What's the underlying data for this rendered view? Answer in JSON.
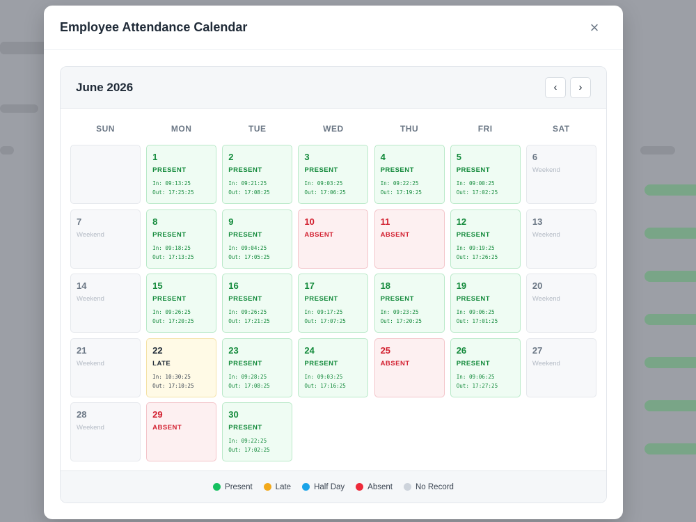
{
  "modal": {
    "title": "Employee Attendance Calendar",
    "close_symbol": "×"
  },
  "calendar": {
    "month_label": "June 2026",
    "prev_symbol": "‹",
    "next_symbol": "›",
    "weekdays": [
      "SUN",
      "MON",
      "TUE",
      "WED",
      "THU",
      "FRI",
      "SAT"
    ],
    "days": [
      {
        "type": "blank"
      },
      {
        "type": "present",
        "day": "1",
        "status": "PRESENT",
        "in": "In: 09:13:25",
        "out": "Out: 17:25:25"
      },
      {
        "type": "present",
        "day": "2",
        "status": "PRESENT",
        "in": "In: 09:21:25",
        "out": "Out: 17:08:25"
      },
      {
        "type": "present",
        "day": "3",
        "status": "PRESENT",
        "in": "In: 09:03:25",
        "out": "Out: 17:06:25"
      },
      {
        "type": "present",
        "day": "4",
        "status": "PRESENT",
        "in": "In: 09:22:25",
        "out": "Out: 17:19:25"
      },
      {
        "type": "present",
        "day": "5",
        "status": "PRESENT",
        "in": "In: 09:00:25",
        "out": "Out: 17:02:25"
      },
      {
        "type": "weekend",
        "day": "6",
        "status": "Weekend"
      },
      {
        "type": "weekend",
        "day": "7",
        "status": "Weekend"
      },
      {
        "type": "present",
        "day": "8",
        "status": "PRESENT",
        "in": "In: 09:18:25",
        "out": "Out: 17:13:25"
      },
      {
        "type": "present",
        "day": "9",
        "status": "PRESENT",
        "in": "In: 09:04:25",
        "out": "Out: 17:05:25"
      },
      {
        "type": "absent",
        "day": "10",
        "status": "ABSENT"
      },
      {
        "type": "absent",
        "day": "11",
        "status": "ABSENT"
      },
      {
        "type": "present",
        "day": "12",
        "status": "PRESENT",
        "in": "In: 09:19:25",
        "out": "Out: 17:26:25"
      },
      {
        "type": "weekend",
        "day": "13",
        "status": "Weekend"
      },
      {
        "type": "weekend",
        "day": "14",
        "status": "Weekend"
      },
      {
        "type": "present",
        "day": "15",
        "status": "PRESENT",
        "in": "In: 09:26:25",
        "out": "Out: 17:20:25"
      },
      {
        "type": "present",
        "day": "16",
        "status": "PRESENT",
        "in": "In: 09:26:25",
        "out": "Out: 17:21:25"
      },
      {
        "type": "present",
        "day": "17",
        "status": "PRESENT",
        "in": "In: 09:17:25",
        "out": "Out: 17:07:25"
      },
      {
        "type": "present",
        "day": "18",
        "status": "PRESENT",
        "in": "In: 09:23:25",
        "out": "Out: 17:20:25"
      },
      {
        "type": "present",
        "day": "19",
        "status": "PRESENT",
        "in": "In: 09:06:25",
        "out": "Out: 17:01:25"
      },
      {
        "type": "weekend",
        "day": "20",
        "status": "Weekend"
      },
      {
        "type": "weekend",
        "day": "21",
        "status": "Weekend"
      },
      {
        "type": "late",
        "day": "22",
        "status": "LATE",
        "in": "In: 10:30:25",
        "out": "Out: 17:10:25"
      },
      {
        "type": "present",
        "day": "23",
        "status": "PRESENT",
        "in": "In: 09:28:25",
        "out": "Out: 17:08:25"
      },
      {
        "type": "present",
        "day": "24",
        "status": "PRESENT",
        "in": "In: 09:03:25",
        "out": "Out: 17:16:25"
      },
      {
        "type": "absent",
        "day": "25",
        "status": "ABSENT"
      },
      {
        "type": "present",
        "day": "26",
        "status": "PRESENT",
        "in": "In: 09:06:25",
        "out": "Out: 17:27:25"
      },
      {
        "type": "weekend",
        "day": "27",
        "status": "Weekend"
      },
      {
        "type": "weekend",
        "day": "28",
        "status": "Weekend"
      },
      {
        "type": "absent",
        "day": "29",
        "status": "ABSENT"
      },
      {
        "type": "present",
        "day": "30",
        "status": "PRESENT",
        "in": "In: 09:22:25",
        "out": "Out: 17:02:25"
      }
    ]
  },
  "legend": [
    {
      "label": "Present",
      "color": "#16c060"
    },
    {
      "label": "Late",
      "color": "#f2a91c"
    },
    {
      "label": "Half Day",
      "color": "#1aa3e8"
    },
    {
      "label": "Absent",
      "color": "#ee2a3a"
    },
    {
      "label": "No Record",
      "color": "#cdd3db"
    }
  ]
}
